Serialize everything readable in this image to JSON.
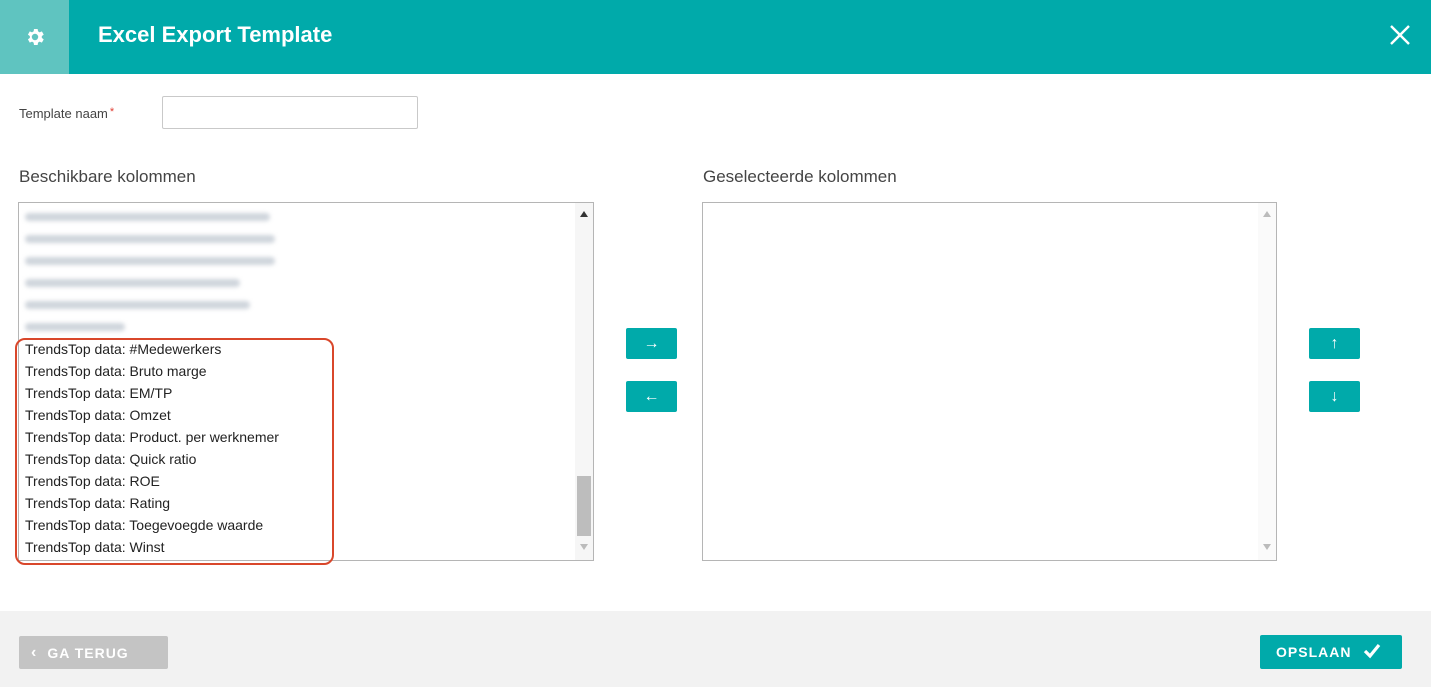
{
  "header": {
    "title": "Excel Export Template",
    "icon": "gear-icon",
    "close_icon": "close-icon"
  },
  "form": {
    "name_label": "Template naam",
    "required_mark": "*",
    "name_value": ""
  },
  "available": {
    "title": "Beschikbare kolommen",
    "visible_items": [
      "TrendsTop data: #Medewerkers",
      "TrendsTop data: Bruto marge",
      "TrendsTop data: EM/TP",
      "TrendsTop data: Omzet",
      "TrendsTop data: Product. per werknemer",
      "TrendsTop data: Quick ratio",
      "TrendsTop data: ROE",
      "TrendsTop data: Rating",
      "TrendsTop data: Toegevoegde waarde",
      "TrendsTop data: Winst"
    ]
  },
  "selected": {
    "title": "Geselecteerde kolommen",
    "items": []
  },
  "transfer": {
    "add_label": "→",
    "remove_label": "←"
  },
  "order": {
    "up_label": "↑",
    "down_label": "↓"
  },
  "footer": {
    "back_label": "GA TERUG",
    "back_icon": "‹",
    "save_label": "OPSLAAN"
  },
  "colors": {
    "accent": "#00aaaa",
    "header_icon_bg": "#5fc4c0",
    "highlight": "#d9472b",
    "disabled": "#c4c4c4"
  }
}
